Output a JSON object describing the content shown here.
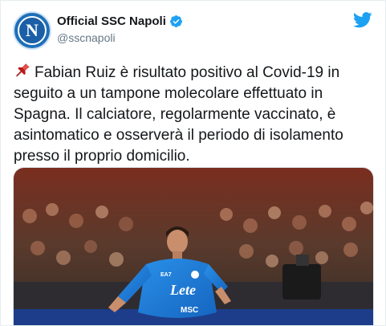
{
  "author": {
    "display_name": "Official SSC Napoli",
    "handle": "@sscnapoli",
    "avatar_letter": "N",
    "verified": true
  },
  "tweet": {
    "pin_icon": "pushpin-icon",
    "text": "Fabian Ruiz è risultato positivo al Covid-19 in seguito a un tampone molecolare effettuato in Spagna. Il calciatore, regolarmente vaccinato, è asintomatico e osserverà il periodo di isolamento presso il proprio domicilio."
  },
  "media": {
    "kind": "photo",
    "description_icon": "football-player-photo",
    "jersey_sponsor": "Lete",
    "jersey_brand": "MSC",
    "kit_maker": "EA7"
  },
  "colors": {
    "twitter_blue": "#1da1f2",
    "verified_blue": "#1da1f2",
    "napoli_blue": "#1e6fb8",
    "text_primary": "#14171a",
    "text_secondary": "#657786"
  }
}
